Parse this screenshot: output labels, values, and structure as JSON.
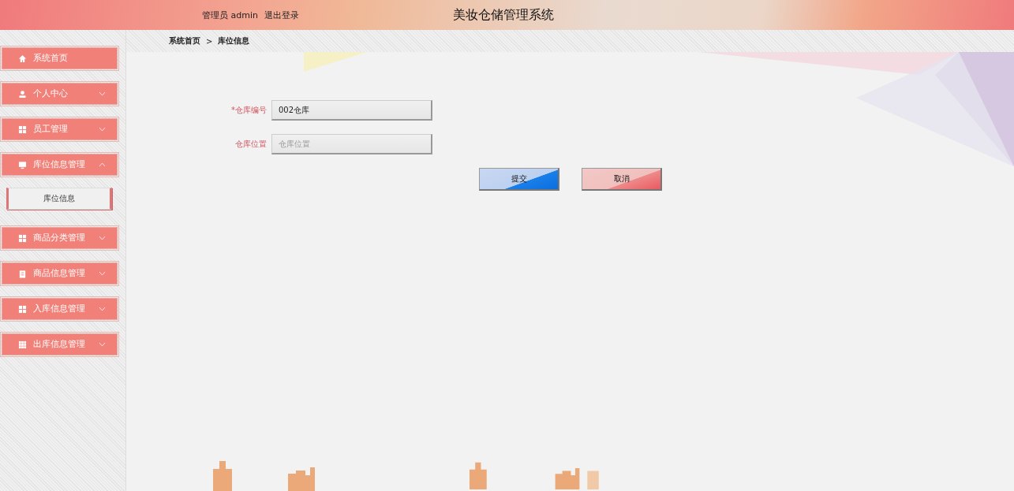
{
  "header": {
    "role": "管理员",
    "user": "admin",
    "logout": "退出登录",
    "title": "美妆仓储管理系统"
  },
  "breadcrumb": {
    "separator": ">",
    "items": [
      "系统首页",
      "库位信息"
    ]
  },
  "sidebar": {
    "items": [
      {
        "label": "系统首页",
        "kind": "link"
      },
      {
        "label": "个人中心",
        "kind": "menu",
        "expanded": false
      },
      {
        "label": "员工管理",
        "kind": "menu",
        "expanded": false
      },
      {
        "label": "库位信息管理",
        "kind": "menu",
        "expanded": true,
        "children": [
          {
            "label": "库位信息",
            "selected": true
          }
        ]
      },
      {
        "label": "商品分类管理",
        "kind": "menu",
        "expanded": false
      },
      {
        "label": "商品信息管理",
        "kind": "menu",
        "expanded": false
      },
      {
        "label": "入库信息管理",
        "kind": "menu",
        "expanded": false
      },
      {
        "label": "出库信息管理",
        "kind": "menu",
        "expanded": false
      }
    ]
  },
  "form": {
    "required_mark": "*",
    "fields": [
      {
        "label": "仓库编号",
        "required": true,
        "value": "002仓库"
      },
      {
        "label": "仓库位置",
        "required": false,
        "placeholder": "仓库位置"
      }
    ],
    "buttons": [
      {
        "label": "提交",
        "kind": "submit"
      },
      {
        "label": "取消",
        "kind": "cancel"
      }
    ]
  }
}
